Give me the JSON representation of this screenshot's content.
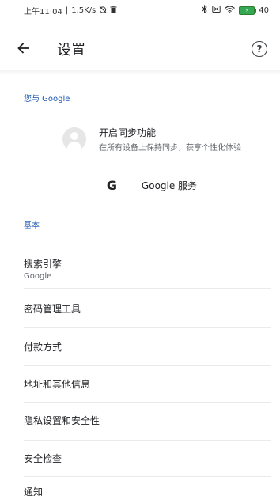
{
  "status_bar": {
    "time": "上午11:04",
    "net_speed": "1.5K/s",
    "battery": "40",
    "icons": [
      "alarm-off-icon",
      "trash-icon",
      "bluetooth-icon",
      "sim-icon",
      "wifi-icon",
      "battery-icon"
    ]
  },
  "toolbar": {
    "title": "设置",
    "back_icon": "back-arrow-icon",
    "help_icon": "help-icon"
  },
  "sections": {
    "google": {
      "header": "您与 Google",
      "sync_title": "开启同步功能",
      "sync_subtitle": "在所有设备上保持同步，获享个性化体验",
      "google_services": "Google 服务"
    },
    "basics": {
      "header": "基本",
      "search_engine_title": "搜索引擎",
      "search_engine_value": "Google",
      "items": [
        "密码管理工具",
        "付款方式",
        "地址和其他信息",
        "隐私设置和安全性",
        "安全检查",
        "通知"
      ]
    }
  },
  "colors": {
    "section_header": "#1a56b0",
    "divider": "#e8eaed",
    "battery": "#34a853"
  }
}
